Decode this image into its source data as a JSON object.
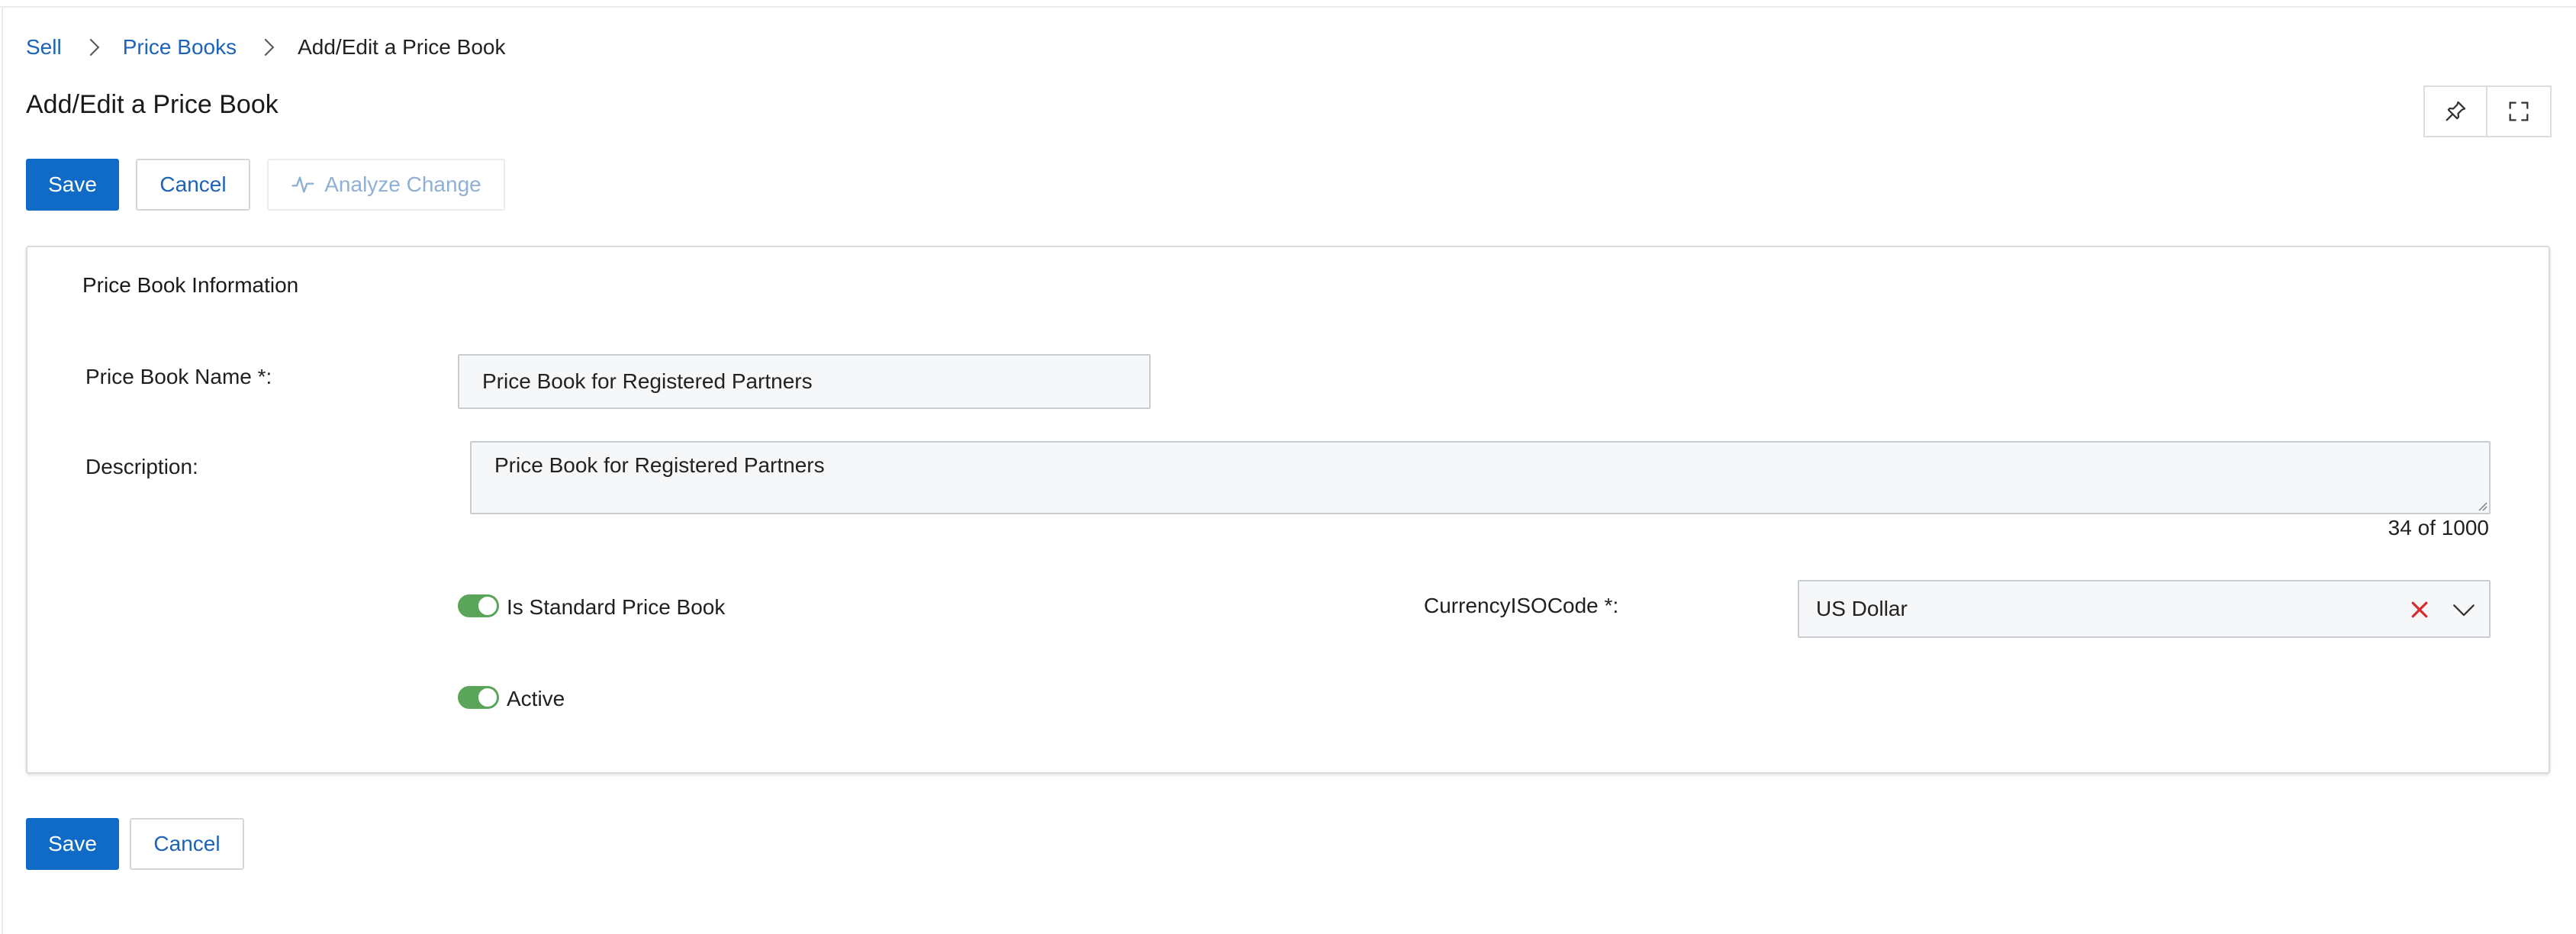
{
  "breadcrumb": {
    "items": [
      {
        "label": "Sell"
      },
      {
        "label": "Price Books"
      },
      {
        "label": "Add/Edit a Price Book"
      }
    ]
  },
  "page": {
    "title": "Add/Edit a Price Book"
  },
  "toolbar": {
    "save_label": "Save",
    "cancel_label": "Cancel",
    "analyze_label": "Analyze Change"
  },
  "section": {
    "title": "Price Book Information"
  },
  "form": {
    "name_label": "Price Book Name",
    "name_required": "*:",
    "name_value": "Price Book for Registered Partners",
    "description_label": "Description:",
    "description_value": "Price Book for Registered Partners",
    "description_counter": "34 of 1000",
    "standard_label": "Is Standard Price Book",
    "standard_on": true,
    "active_label": "Active",
    "active_on": true,
    "currency_label": "CurrencyISOCode",
    "currency_required": "*:",
    "currency_value": "US Dollar"
  },
  "footer": {
    "save_label": "Save",
    "cancel_label": "Cancel"
  },
  "colors": {
    "primary": "#0f6bc5",
    "link": "#1d63b8",
    "toggle_on": "#5aa55a",
    "clear_red": "#d62c2c"
  },
  "icons": [
    "chevron-right-icon",
    "pin-icon",
    "fullscreen-icon",
    "pulse-icon",
    "clear-x-icon",
    "chevron-down-icon"
  ]
}
